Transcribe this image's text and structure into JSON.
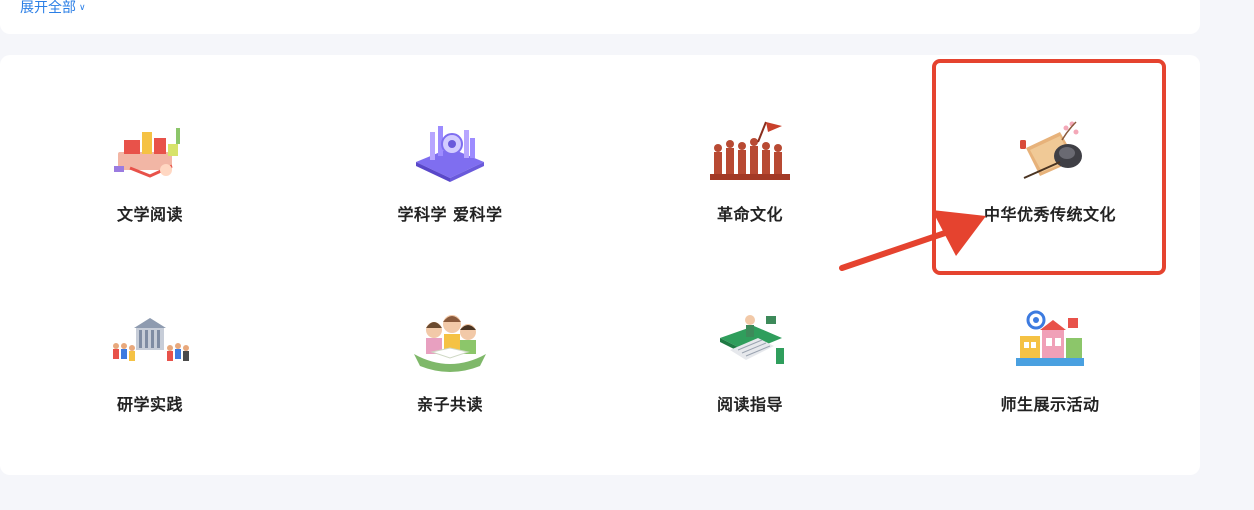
{
  "top": {
    "expand_label": "展开全部"
  },
  "categories": [
    {
      "label": "文学阅读",
      "icon": "books-reading-icon"
    },
    {
      "label": "学科学 爱科学",
      "icon": "science-lab-icon"
    },
    {
      "label": "革命文化",
      "icon": "revolution-silhouette-icon"
    },
    {
      "label": "中华优秀传统文化",
      "icon": "ink-stone-brush-icon"
    },
    {
      "label": "研学实践",
      "icon": "study-tour-group-icon"
    },
    {
      "label": "亲子共读",
      "icon": "family-reading-icon"
    },
    {
      "label": "阅读指导",
      "icon": "teacher-screen-icon"
    },
    {
      "label": "师生展示活动",
      "icon": "school-building-icon"
    }
  ],
  "highlight": {
    "target": "中华优秀传统文化",
    "color": "#e5432f"
  },
  "colors": {
    "link": "#2b7fe6",
    "background": "#f5f6fa",
    "card": "#ffffff"
  }
}
